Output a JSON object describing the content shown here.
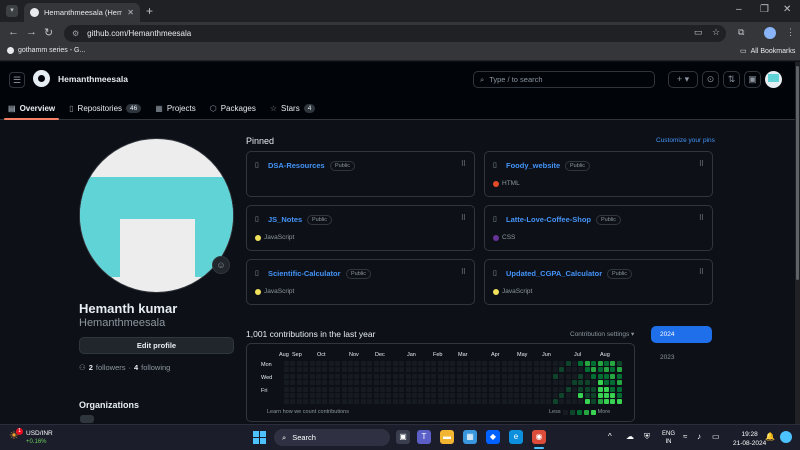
{
  "browser": {
    "tab_title": "Hemanthmeesala (Hemanth kumar)",
    "url": "github.com/Hemanthmeesala",
    "bookmark": "gothamm series - G...",
    "all_bookmarks": "All Bookmarks"
  },
  "header": {
    "username": "Hemanthmeesala",
    "search_placeholder": "Type / to search",
    "tabs": [
      {
        "label": "Overview",
        "icon": "book-icon",
        "active": true
      },
      {
        "label": "Repositories",
        "icon": "repo-icon",
        "count": "46"
      },
      {
        "label": "Projects",
        "icon": "table-icon"
      },
      {
        "label": "Packages",
        "icon": "package-icon"
      },
      {
        "label": "Stars",
        "icon": "star-icon",
        "count": "4"
      }
    ]
  },
  "profile": {
    "name": "Hemanth kumar",
    "login": "Hemanthmeesala",
    "edit_label": "Edit profile",
    "followers_count": "2",
    "followers_label": "followers",
    "separator": "·",
    "following_count": "4",
    "following_label": "following",
    "orgs_title": "Organizations"
  },
  "pinned": {
    "title": "Pinned",
    "customize": "Customize your pins",
    "repos": [
      {
        "name": "DSA-Resources",
        "visibility": "Public",
        "language": "",
        "color": ""
      },
      {
        "name": "Foody_website",
        "visibility": "Public",
        "language": "HTML",
        "color": "#e34c26"
      },
      {
        "name": "JS_Notes",
        "visibility": "Public",
        "language": "JavaScript",
        "color": "#f1e05a"
      },
      {
        "name": "Latte-Love-Coffee-Shop",
        "visibility": "Public",
        "language": "CSS",
        "color": "#663399"
      },
      {
        "name": "Scientific-Calculator",
        "visibility": "Public",
        "language": "JavaScript",
        "color": "#f1e05a"
      },
      {
        "name": "Updated_CGPA_Calculator",
        "visibility": "Public",
        "language": "JavaScript",
        "color": "#f1e05a"
      }
    ]
  },
  "contributions": {
    "title": "1,001 contributions in the last year",
    "settings": "Contribution settings ▾",
    "months": [
      "Aug",
      "Sep",
      "Oct",
      "Nov",
      "Dec",
      "Jan",
      "Feb",
      "Mar",
      "Apr",
      "May",
      "Jun",
      "Jul",
      "Aug"
    ],
    "days": [
      "Mon",
      "Wed",
      "Fri"
    ],
    "learn": "Learn how we count contributions",
    "less": "Less",
    "more": "More",
    "years": [
      "2024",
      "2023"
    ],
    "colors": [
      "#161b22",
      "#0e4429",
      "#006d32",
      "#26a641",
      "#39d353"
    ]
  },
  "taskbar": {
    "pair": "USD/INR",
    "change": "+0.16%",
    "search": "Search",
    "lang_top": "ENG",
    "lang_bottom": "IN",
    "time": "19:28",
    "date": "21-08-2024",
    "weather_badge": "1"
  }
}
